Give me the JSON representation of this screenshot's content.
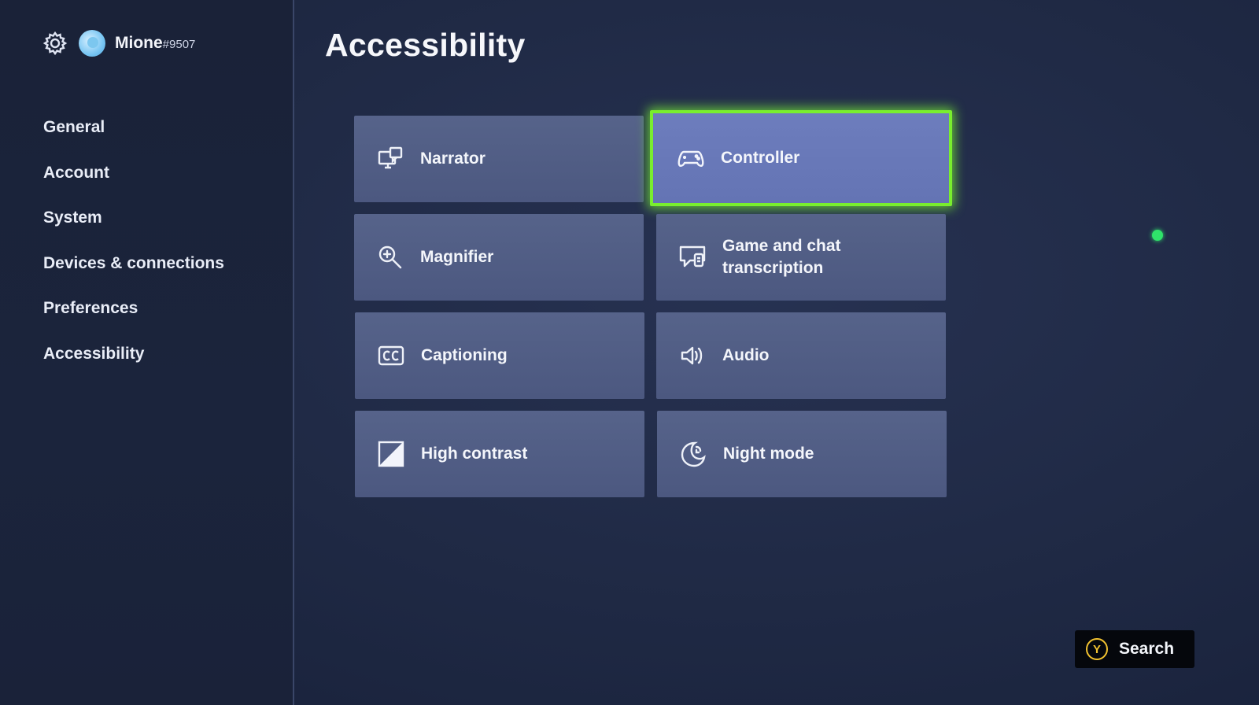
{
  "profile": {
    "gamertag": "Mione",
    "gamertag_suffix": "#9507"
  },
  "sidebar": {
    "items": [
      {
        "label": "General"
      },
      {
        "label": "Account"
      },
      {
        "label": "System"
      },
      {
        "label": "Devices & connections"
      },
      {
        "label": "Preferences"
      },
      {
        "label": "Accessibility"
      }
    ]
  },
  "main": {
    "title": "Accessibility",
    "tiles": [
      {
        "label": "Narrator",
        "icon": "narrator-icon"
      },
      {
        "label": "Controller",
        "icon": "controller-icon",
        "selected": true
      },
      {
        "label": "Magnifier",
        "icon": "magnifier-icon"
      },
      {
        "label": "Game and chat transcription",
        "icon": "chat-transcription-icon"
      },
      {
        "label": "Captioning",
        "icon": "cc-icon"
      },
      {
        "label": "Audio",
        "icon": "speaker-icon"
      },
      {
        "label": "High contrast",
        "icon": "high-contrast-icon"
      },
      {
        "label": "Night mode",
        "icon": "night-mode-icon"
      }
    ]
  },
  "footer": {
    "search_button_key": "Y",
    "search_label": "Search"
  },
  "colors": {
    "focus_outline": "#79ee2e",
    "tile": "#4f5b83",
    "tile_selected": "#6878b8",
    "status_dot": "#2fe36a",
    "y_button": "#f2c230"
  }
}
